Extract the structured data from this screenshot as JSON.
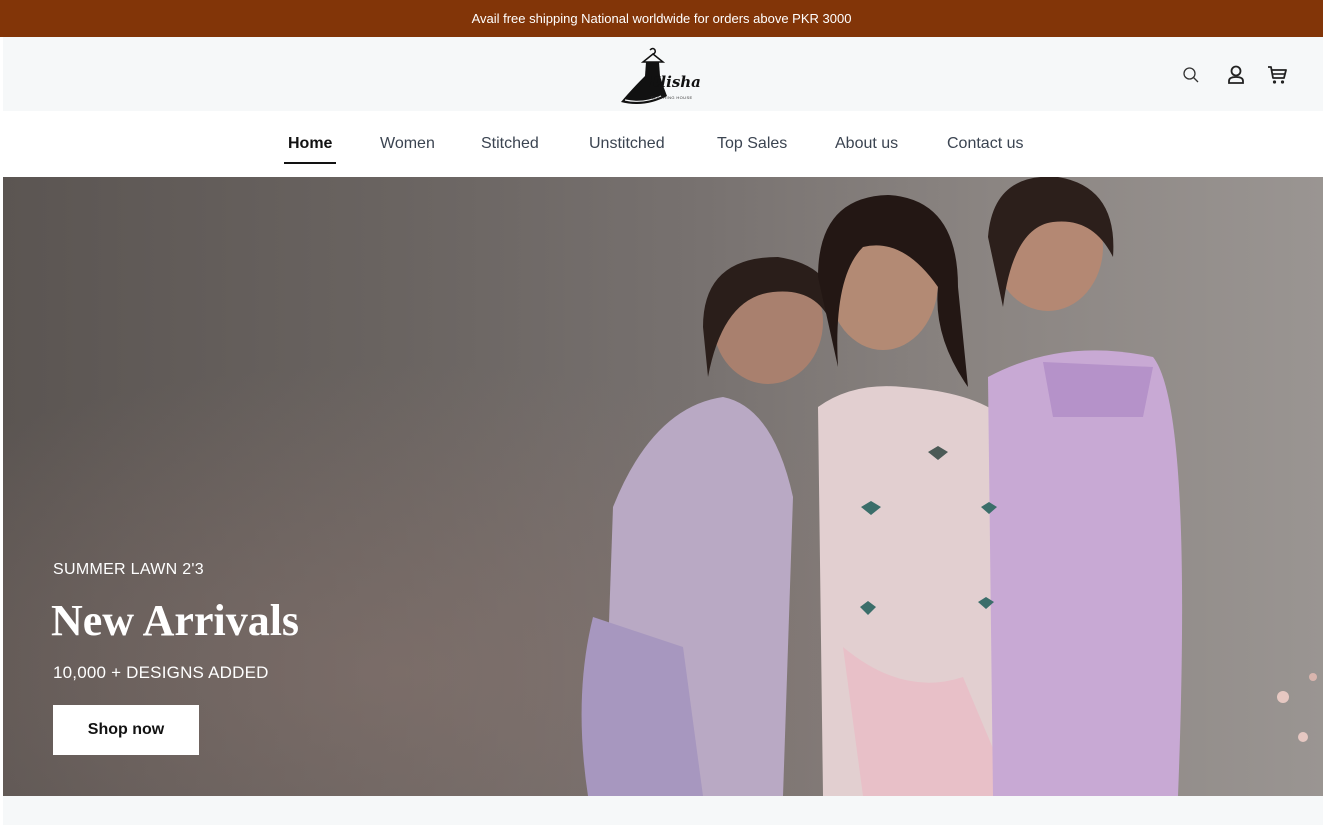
{
  "announcement": {
    "text": "Avail free shipping National worldwide for orders above PKR 3000"
  },
  "header": {
    "logo": {
      "name": "Elisha",
      "tagline": "CLOTHING HOUSE"
    },
    "icons": [
      "search-icon",
      "account-icon",
      "cart-icon"
    ]
  },
  "nav": {
    "items": [
      {
        "label": "Home"
      },
      {
        "label": "Women"
      },
      {
        "label": "Stitched"
      },
      {
        "label": "Unstitched"
      },
      {
        "label": "Top Sales"
      },
      {
        "label": "About us"
      },
      {
        "label": "Contact us"
      }
    ],
    "active": "Home"
  },
  "hero": {
    "kicker": "SUMMER LAWN 2'3",
    "title": "New Arrivals",
    "subtitle": "10,000 + DESIGNS ADDED",
    "button_label": "Shop now"
  },
  "colors": {
    "announcement_bg": "#823508",
    "header_bg": "#f6f8f9",
    "text_dark": "#121212",
    "nav_text": "#3b4451"
  }
}
